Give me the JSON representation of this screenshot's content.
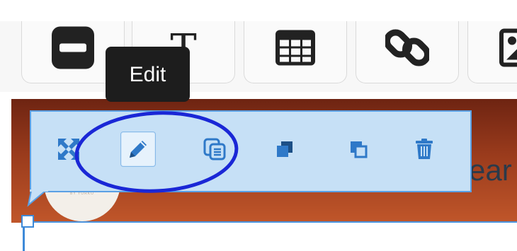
{
  "toolbar": {
    "tools": [
      {
        "name": "divider-tool",
        "icon": "minus-square-icon"
      },
      {
        "name": "text-tool",
        "icon": "text-icon",
        "glyph": "T"
      },
      {
        "name": "table-tool",
        "icon": "table-icon"
      },
      {
        "name": "link-tool",
        "icon": "link-icon"
      },
      {
        "name": "image-tool",
        "icon": "image-icon"
      }
    ]
  },
  "tooltip": {
    "label": "Edit"
  },
  "action_bar": {
    "actions": [
      {
        "name": "move",
        "icon": "move-arrows-icon"
      },
      {
        "name": "edit",
        "icon": "pencil-icon",
        "active": true
      },
      {
        "name": "duplicate",
        "icon": "duplicate-icon"
      },
      {
        "name": "bring-to-front",
        "icon": "bring-front-icon"
      },
      {
        "name": "send-to-back",
        "icon": "send-back-icon"
      },
      {
        "name": "delete",
        "icon": "trash-icon"
      }
    ]
  },
  "banner": {
    "peek_text": "ear",
    "avatar_caption": "BY YORKO"
  },
  "colors": {
    "accent": "#2f79c8",
    "action_bar_bg": "#c6e0f6",
    "annotation_circle": "#1a27d6",
    "tooltip_bg": "#1d1d1d",
    "banner_top": "#6e2412",
    "banner_bottom": "#c0562a"
  }
}
